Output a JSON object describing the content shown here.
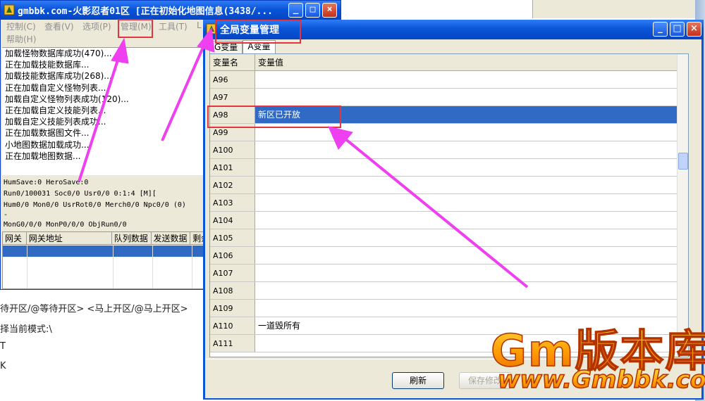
{
  "main_window": {
    "title": "gmbbk.com-火影忍者01区 [正在初始化地图信息(3438/...",
    "menu": [
      "控制(C)",
      "查看(V)",
      "选项(P)",
      "管理(M)",
      "工具(T)",
      "帮助(H)"
    ],
    "menu_partial": "L",
    "log_lines": [
      "加载怪物数据库成功(470)...",
      "正在加载技能数据库...",
      "加载技能数据库成功(268)...",
      "正在加载自定义怪物列表...",
      "加载自定义怪物列表成功(120)...",
      "正在加载自定义技能列表...",
      "加载自定义技能列表成功...",
      "正在加载数据图文件...",
      "小地图数据加载成功...",
      "正在加载地图数据..."
    ],
    "status_lines": [
      "HumSave:0 HeroSave:0",
      "Run0/100031 Soc0/0 Usr0/0          0:1:4  [M][",
      "Hum0/0 Mon0/0 UsrRot0/0 Merch0/0 Npc0/0 (0)",
      "-",
      "MonG0/0/0 MonP0/0/0 ObjRun0/0"
    ],
    "gateway_columns": [
      "网关",
      "网关地址",
      "队列数据",
      "发送数据",
      "剩余"
    ]
  },
  "background_text": [
    "待开区/@等待开区>   <马上开区/@马上开区>",
    "择当前模式:\\",
    "T",
    "K"
  ],
  "var_window": {
    "title": "全局变量管理",
    "tabs": [
      "G变量",
      "A变量"
    ],
    "active_tab": "A变量",
    "headers": {
      "name": "变量名",
      "value": "变量值"
    },
    "rows": [
      {
        "name": "A96",
        "value": ""
      },
      {
        "name": "A97",
        "value": ""
      },
      {
        "name": "A98",
        "value": "新区已开放"
      },
      {
        "name": "A99",
        "value": ""
      },
      {
        "name": "A100",
        "value": ""
      },
      {
        "name": "A101",
        "value": ""
      },
      {
        "name": "A102",
        "value": ""
      },
      {
        "name": "A103",
        "value": ""
      },
      {
        "name": "A104",
        "value": ""
      },
      {
        "name": "A105",
        "value": ""
      },
      {
        "name": "A106",
        "value": ""
      },
      {
        "name": "A107",
        "value": ""
      },
      {
        "name": "A108",
        "value": ""
      },
      {
        "name": "A109",
        "value": ""
      },
      {
        "name": "A110",
        "value": "一道毁所有"
      },
      {
        "name": "A111",
        "value": ""
      }
    ],
    "selected_row": "A98",
    "buttons": {
      "refresh": "刷新",
      "save": "保存修改"
    }
  },
  "watermark": {
    "line1": "Gm版本库",
    "line2": "www.Gmbbk.com"
  },
  "colors": {
    "titlebar": "#0a55d8",
    "selection": "#316ac5",
    "highlight_box": "#e3353b",
    "arrow": "#ee3ff0"
  }
}
